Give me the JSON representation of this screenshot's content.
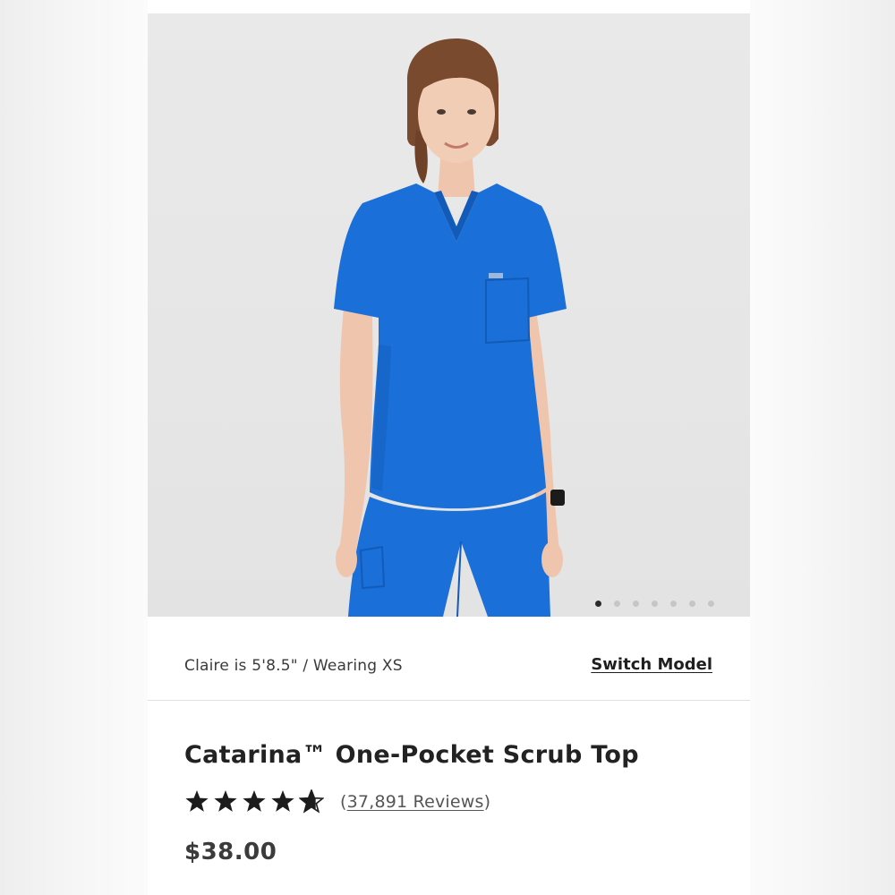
{
  "gallery": {
    "image_count": 7,
    "active_index": 0,
    "scrub_color": "#1a6fd8"
  },
  "model": {
    "info": "Claire is 5'8.5\" / Wearing XS",
    "switch_label": "Switch Model"
  },
  "product": {
    "title": "Catarina™ One-Pocket Scrub Top",
    "rating": 4.8,
    "rating_max": 5,
    "review_open": "(",
    "review_count_text": "37,891 Reviews",
    "review_close": ")",
    "price": "$38.00"
  },
  "icons": {
    "star": "star-icon",
    "carousel_dot": "carousel-dot"
  }
}
